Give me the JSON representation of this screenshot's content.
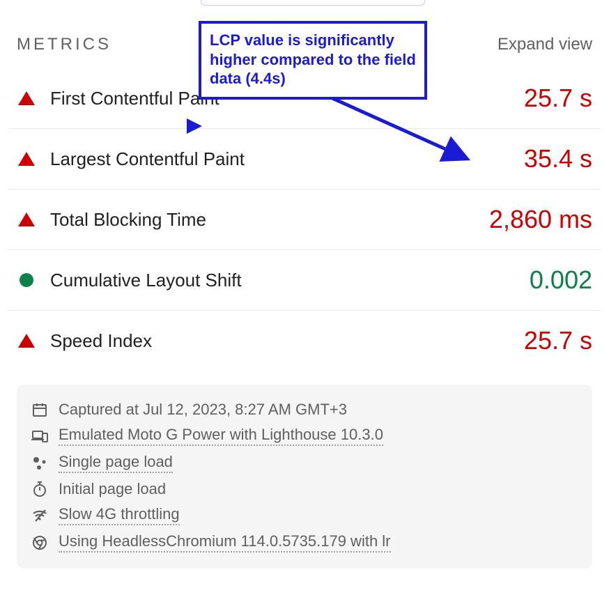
{
  "header": {
    "title": "METRICS",
    "expand": "Expand view"
  },
  "annotation": {
    "text": "LCP value is significantly higher compared to the field data (4.4s)"
  },
  "metrics": [
    {
      "name": "First Contentful Paint",
      "value": "25.7 s",
      "status": "red"
    },
    {
      "name": "Largest Contentful Paint",
      "value": "35.4 s",
      "status": "red"
    },
    {
      "name": "Total Blocking Time",
      "value": "2,860 ms",
      "status": "red"
    },
    {
      "name": "Cumulative Layout Shift",
      "value": "0.002",
      "status": "green"
    },
    {
      "name": "Speed Index",
      "value": "25.7 s",
      "status": "red"
    }
  ],
  "environment": {
    "captured": "Captured at Jul 12, 2023, 8:27 AM GMT+3",
    "emulated": "Emulated Moto G Power with Lighthouse 10.3.0",
    "pageload": "Single page load",
    "initial": "Initial page load",
    "throttling": "Slow 4G throttling",
    "browser": "Using HeadlessChromium 114.0.5735.179 with lr"
  }
}
